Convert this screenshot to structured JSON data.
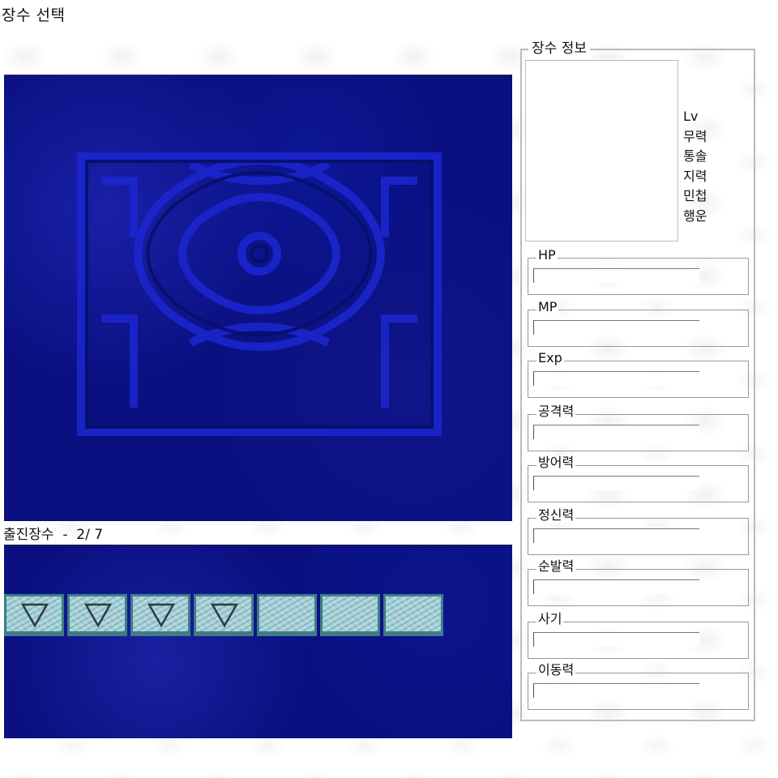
{
  "window": {
    "title": "장수 선택"
  },
  "sortie": {
    "label": "출진장수  -  2/ 7"
  },
  "roster": {
    "slots": [
      {
        "has_marker": true
      },
      {
        "has_marker": true
      },
      {
        "has_marker": true
      },
      {
        "has_marker": true
      },
      {
        "has_marker": false
      },
      {
        "has_marker": false
      },
      {
        "has_marker": false
      }
    ]
  },
  "info": {
    "title": "장수 정보",
    "attributes": [
      "Lv",
      "무력",
      "통솔",
      "지력",
      "민첩",
      "행운"
    ],
    "stats": [
      "HP",
      "MP",
      "Exp",
      "공격력",
      "방어력",
      "정신력",
      "순발력",
      "사기",
      "이동력"
    ]
  },
  "colors": {
    "board_blue": "#0a1080",
    "pattern_blue": "#1a22c8",
    "slot_fill": "#a7d3da",
    "slot_border": "#3f7c88"
  }
}
